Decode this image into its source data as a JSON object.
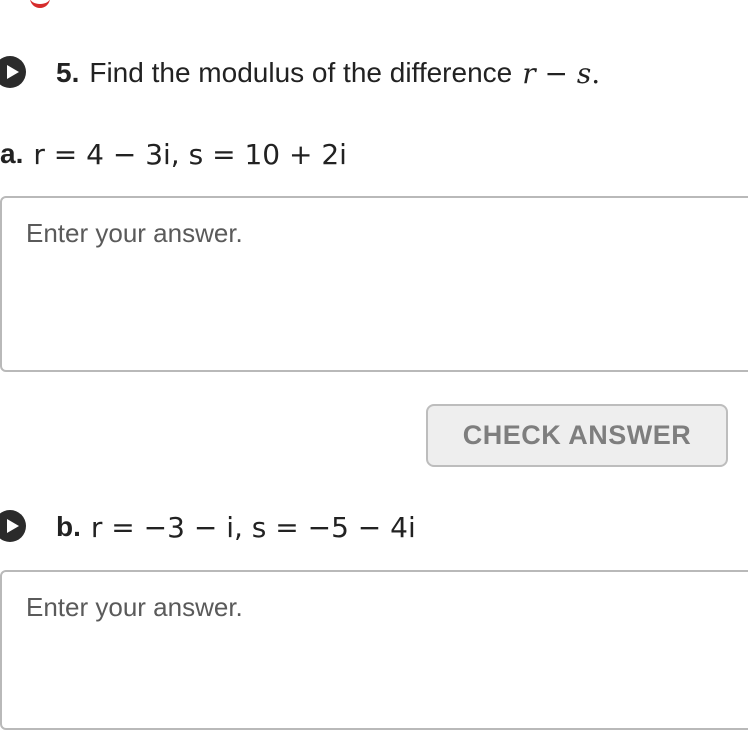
{
  "question": {
    "number": "5.",
    "text": "Find the modulus of the difference",
    "expr_r": "r",
    "expr_op": " − ",
    "expr_s": "s",
    "expr_end": "."
  },
  "part_a": {
    "label": "a.",
    "expr": "r = 4 − 3i, s = 10 + 2i",
    "placeholder": "Enter your answer."
  },
  "check_label": "CHECK ANSWER",
  "part_b": {
    "label": "b.",
    "expr": "r = −3 − i, s = −5 − 4i",
    "placeholder": "Enter your answer."
  },
  "colors": {
    "accent_red": "#d62b2b",
    "play_icon": "#2b2b2b",
    "button_bg": "#eeeeee"
  },
  "icons": {
    "question_audio": "play-icon",
    "part_b_audio": "play-icon"
  }
}
